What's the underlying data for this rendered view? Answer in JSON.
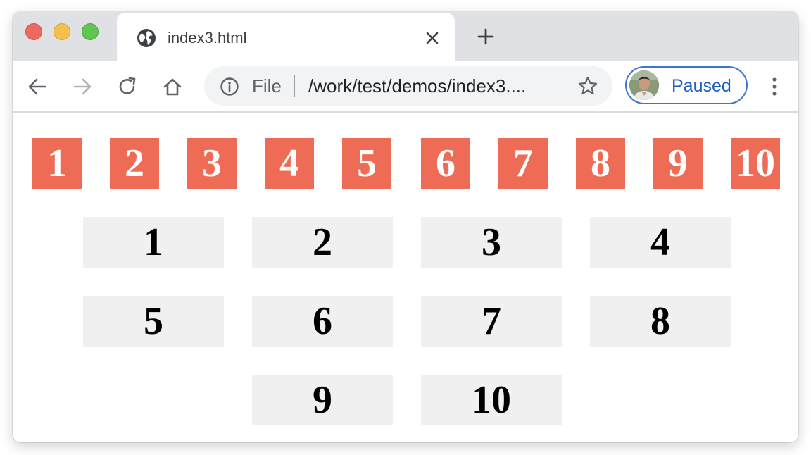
{
  "browser": {
    "tab": {
      "title": "index3.html"
    },
    "address_bar": {
      "scheme_label": "File",
      "url": "/work/test/demos/index3...."
    },
    "profile": {
      "label": "Paused"
    }
  },
  "content": {
    "flex_row": {
      "items": [
        "1",
        "2",
        "3",
        "4",
        "5",
        "6",
        "7",
        "8",
        "9",
        "10"
      ],
      "color": "#ee6c55"
    },
    "grid": {
      "items": [
        "1",
        "2",
        "3",
        "4",
        "5",
        "6",
        "7",
        "8",
        "9",
        "10"
      ],
      "color": "#f0f0f0"
    }
  }
}
